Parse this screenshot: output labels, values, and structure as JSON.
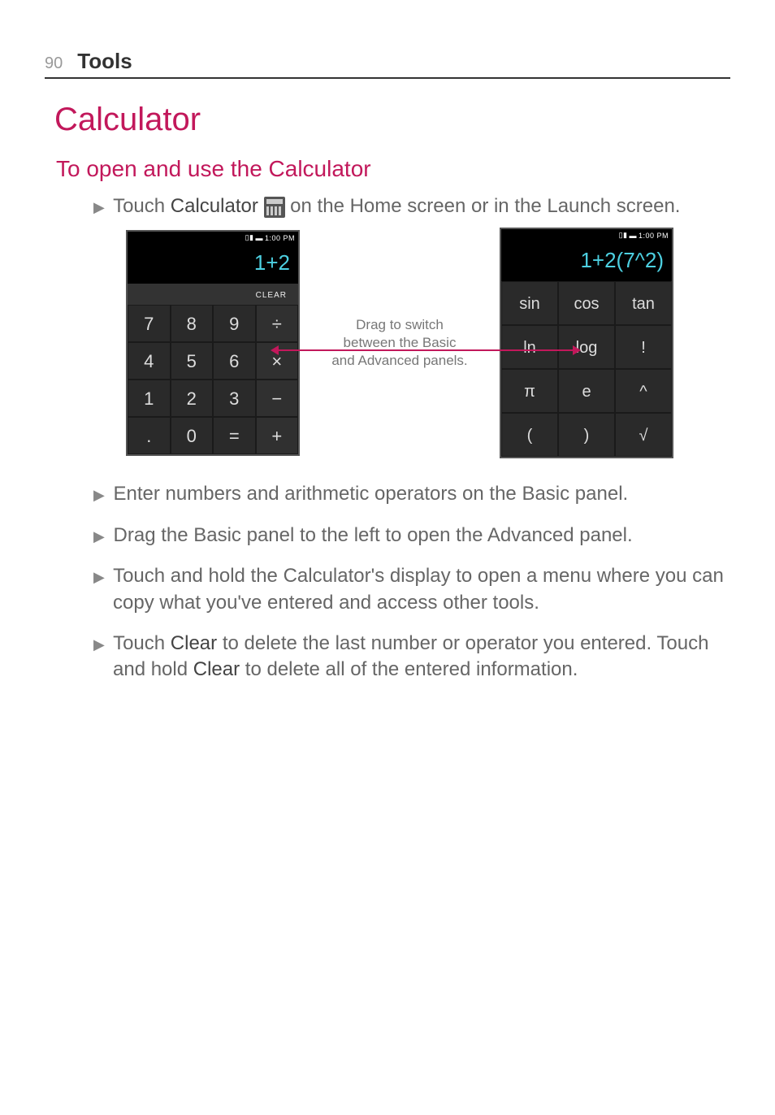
{
  "header": {
    "page_number": "90",
    "section": "Tools"
  },
  "title": "Calculator",
  "subtitle": "To open and use the Calculator",
  "intro": {
    "pre": "Touch ",
    "app_name": "Calculator",
    "post": " on the Home screen or in the Launch screen."
  },
  "status_bar": {
    "time": "1:00 PM"
  },
  "calc_basic": {
    "display": "1+2",
    "clear": "CLEAR",
    "keys": [
      [
        "7",
        "8",
        "9",
        "÷"
      ],
      [
        "4",
        "5",
        "6",
        "×"
      ],
      [
        "1",
        "2",
        "3",
        "−"
      ],
      [
        ".",
        "0",
        "=",
        "+"
      ]
    ]
  },
  "caption": {
    "line1": "Drag to switch",
    "line2": "between the Basic",
    "line3": "and Advanced panels."
  },
  "calc_adv": {
    "display": "1+2(7^2)",
    "keys": [
      [
        "sin",
        "cos",
        "tan"
      ],
      [
        "ln",
        "log",
        "!"
      ],
      [
        "π",
        "e",
        "^"
      ],
      [
        "(",
        ")",
        "√"
      ]
    ]
  },
  "bullets": {
    "b1": "Enter numbers and arithmetic operators on the Basic panel.",
    "b2": "Drag the Basic panel to the left to open the Advanced panel.",
    "b3": "Touch and hold the Calculator's display to open a menu where you can copy what you've entered and access other tools.",
    "b4_pre": "Touch ",
    "b4_clear1": "Clear",
    "b4_mid": " to delete the last number or operator you entered. Touch and hold ",
    "b4_clear2": "Clear",
    "b4_post": " to delete all of the entered information."
  }
}
